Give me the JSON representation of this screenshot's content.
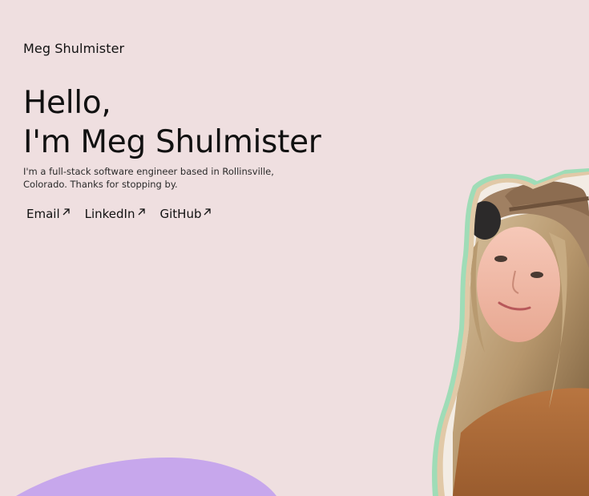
{
  "site": {
    "name": "Meg Shulmister"
  },
  "hero": {
    "line1": "Hello,",
    "line2": "I'm Meg Shulmister",
    "intro": "I'm a full-stack software engineer based in Rollinsville, Colorado. Thanks for stopping by."
  },
  "links": [
    {
      "label": "Email",
      "icon": "external-arrow-icon"
    },
    {
      "label": "LinkedIn",
      "icon": "external-arrow-icon"
    },
    {
      "label": "GitHub",
      "icon": "external-arrow-icon"
    }
  ],
  "colors": {
    "background": "#efdfe0",
    "blob": "#c7a7ec",
    "outline_green": "#9fdcb7",
    "outline_tan": "#e1c9a7",
    "text": "#111111"
  }
}
